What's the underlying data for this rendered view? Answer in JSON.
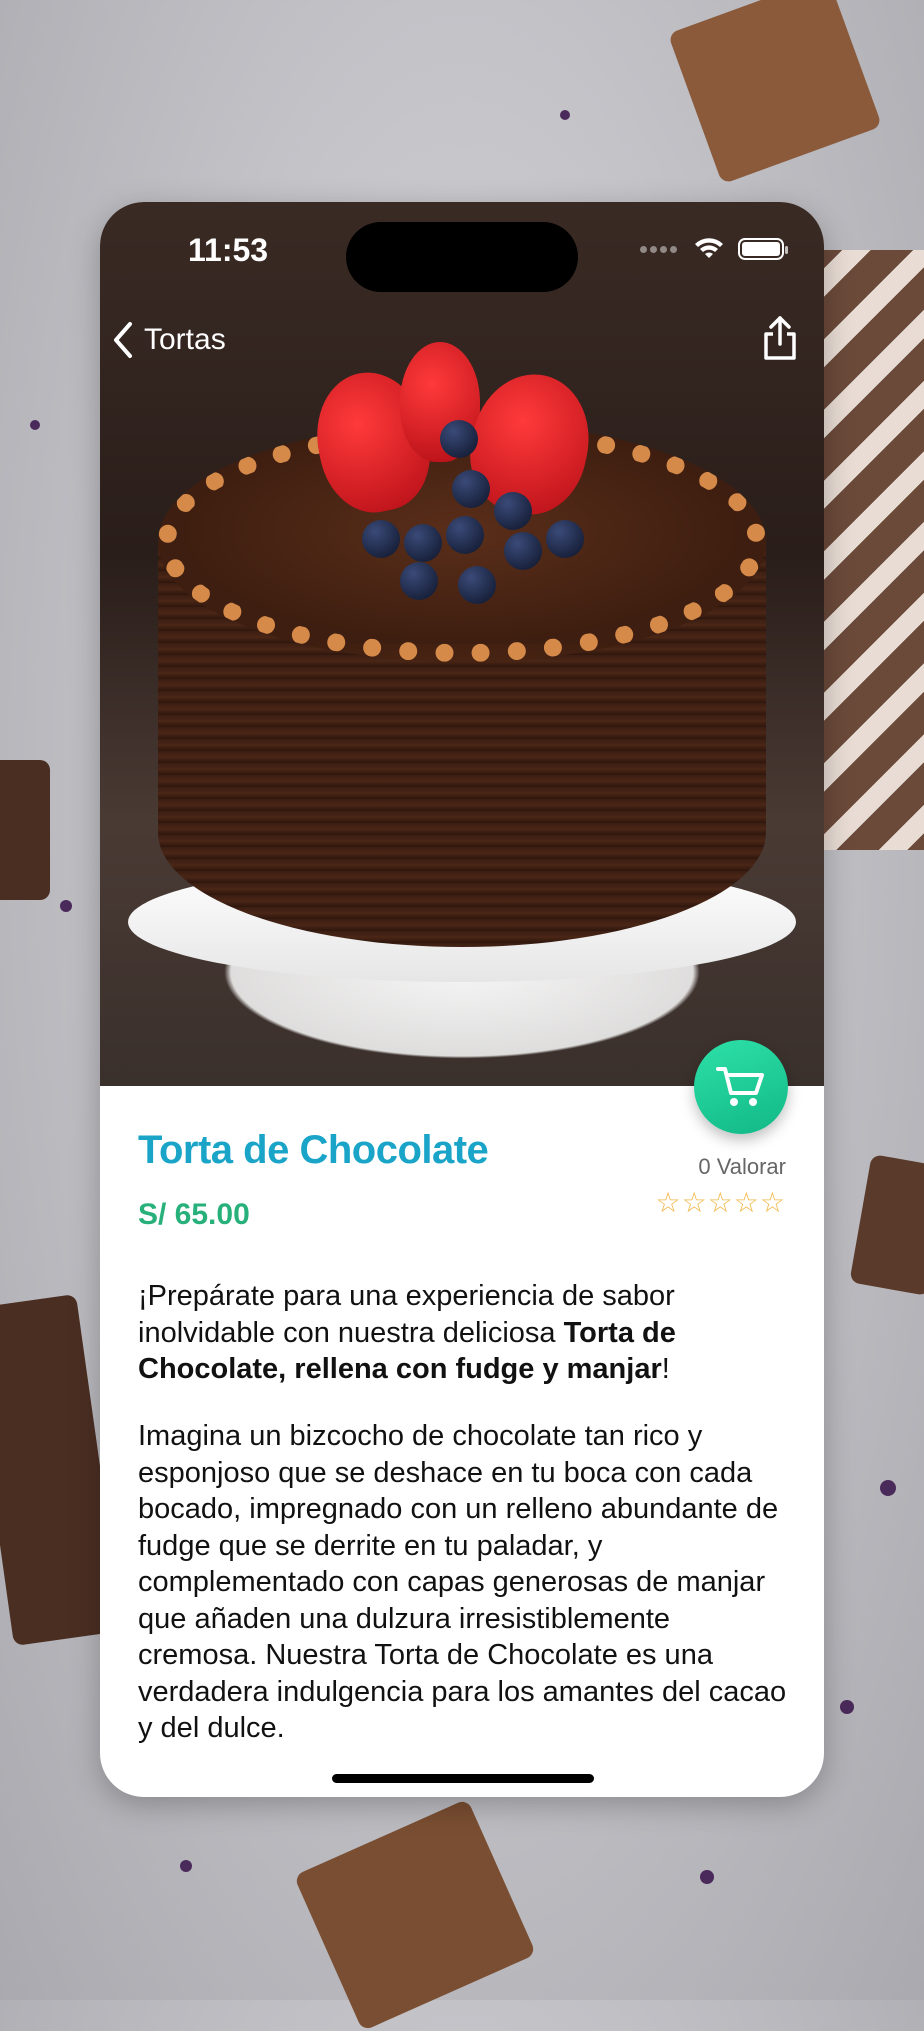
{
  "status_bar": {
    "time": "11:53"
  },
  "nav": {
    "back_label": "Tortas"
  },
  "product": {
    "name": "Torta de Chocolate",
    "price": "S/ 65.00",
    "rating_label": "0 Valorar",
    "stars": "☆☆☆☆☆",
    "rating_value": 0,
    "rating_max": 5,
    "description_p1": {
      "text1": "¡Prepárate para una experiencia de sabor inolvidable con nuestra deliciosa ",
      "bold": "Torta de Chocolate, rellena con fudge y manjar",
      "text2": "!"
    },
    "description_p2": "Imagina un bizcocho de chocolate tan rico y esponjoso que se deshace en tu boca con cada bocado, impregnado con un relleno abundante de fudge que se derrite en tu paladar, y complementado con capas generosas de manjar que añaden una dulzura irresistiblemente cremosa. Nuestra Torta de Chocolate es una verdadera indulgencia para los amantes del cacao y del dulce."
  },
  "icons": {
    "back": "chevron-left-icon",
    "share": "share-icon",
    "cart": "cart-icon",
    "wifi": "wifi-icon",
    "battery": "battery-icon"
  },
  "colors": {
    "title": "#1aa4c8",
    "price": "#27b07a",
    "cart_button": "#1cc894",
    "stars": "#f2b74a"
  }
}
